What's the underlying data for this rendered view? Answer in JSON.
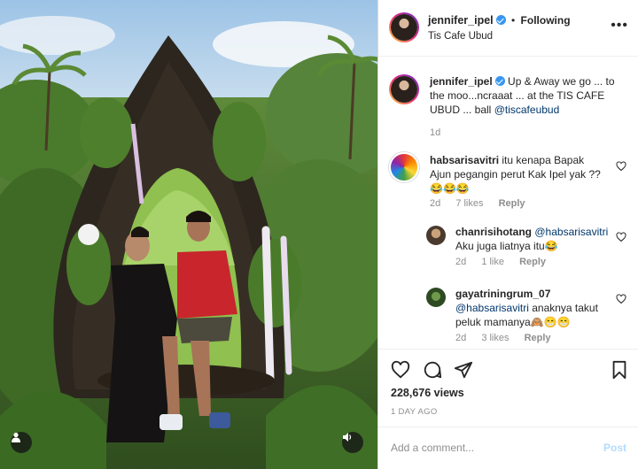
{
  "post": {
    "username": "jennifer_ipel",
    "follow_label": "Following",
    "separator": "•",
    "location": "Tis Cafe Ubud",
    "more_label": "•••"
  },
  "caption": {
    "username": "jennifer_ipel",
    "text": "Up & Away we go ... to the moo...ncraaat ... at the TIS CAFE UBUD ... ball",
    "mention": "@tiscafeubud",
    "time": "1d"
  },
  "comments": [
    {
      "username": "habsarisavitri",
      "text": "itu kenapa Bapak Ajun pegangin perut Kak Ipel yak ?? 😂😂😂",
      "time": "2d",
      "likes": "7 likes",
      "reply_label": "Reply"
    },
    {
      "username": "chanrisihotang",
      "mention": "@habsarisavitri",
      "text": "Aku juga liatnya itu😂",
      "time": "2d",
      "likes": "1 like",
      "reply_label": "Reply"
    },
    {
      "username": "gayatriningrum_07",
      "mention": "@habsarisavitri",
      "text": "anaknya takut peluk mamanya🙈😁😁",
      "time": "2d",
      "likes": "3 likes",
      "reply_label": "Reply"
    }
  ],
  "stats": {
    "views": "228,676 views",
    "time_ago": "1 DAY AGO"
  },
  "add_comment": {
    "placeholder": "Add a comment...",
    "post_label": "Post"
  },
  "colors": {
    "verified": "#3897f0",
    "mention": "#00376b",
    "muted": "#8e8e8e",
    "post_disabled": "#b3dbff"
  }
}
